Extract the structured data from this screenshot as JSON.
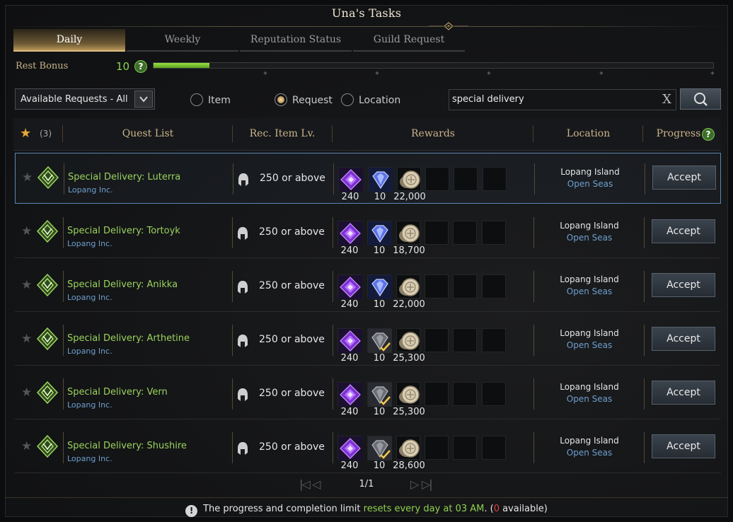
{
  "window": {
    "title": "Una's Tasks"
  },
  "tabs": [
    {
      "label": "Daily",
      "active": true
    },
    {
      "label": "Weekly",
      "active": false
    },
    {
      "label": "Reputation Status",
      "active": false
    },
    {
      "label": "Guild Request",
      "active": false
    }
  ],
  "rest_bonus": {
    "label": "Rest Bonus",
    "value": "10",
    "help": "?",
    "progress_percent": 10
  },
  "filter": {
    "dropdown_value": "Available Requests - All",
    "dropdown_arrow": "chevron-down-icon",
    "radios": [
      {
        "label": "Item",
        "selected": false
      },
      {
        "label": "Request",
        "selected": true
      },
      {
        "label": "Location",
        "selected": false
      }
    ],
    "search_value": "special delivery",
    "clear_label": "X",
    "search_icon": "magnifier-icon"
  },
  "header": {
    "favorites_count": "(3)",
    "quest_list": "Quest List",
    "rec_item_lv": "Rec. Item Lv.",
    "rewards": "Rewards",
    "location": "Location",
    "progress": "Progress",
    "progress_help": "?"
  },
  "rows": [
    {
      "name": "Special Delivery: Luterra",
      "org": "Lopang Inc.",
      "level": "250 or above",
      "reward1": "240",
      "reward2": "10",
      "reward2_checked": false,
      "reward3": "22,000",
      "loc1": "Lopang Island",
      "loc2": "Open Seas",
      "action": "Accept"
    },
    {
      "name": "Special Delivery: Tortoyk",
      "org": "Lopang Inc.",
      "level": "250 or above",
      "reward1": "240",
      "reward2": "10",
      "reward2_checked": false,
      "reward3": "18,700",
      "loc1": "Lopang Island",
      "loc2": "Open Seas",
      "action": "Accept"
    },
    {
      "name": "Special Delivery: Anikka",
      "org": "Lopang Inc.",
      "level": "250 or above",
      "reward1": "240",
      "reward2": "10",
      "reward2_checked": false,
      "reward3": "22,000",
      "loc1": "Lopang Island",
      "loc2": "Open Seas",
      "action": "Accept"
    },
    {
      "name": "Special Delivery: Arthetine",
      "org": "Lopang Inc.",
      "level": "250 or above",
      "reward1": "240",
      "reward2": "10",
      "reward2_checked": true,
      "reward3": "25,300",
      "loc1": "Lopang Island",
      "loc2": "Open Seas",
      "action": "Accept"
    },
    {
      "name": "Special Delivery: Vern",
      "org": "Lopang Inc.",
      "level": "250 or above",
      "reward1": "240",
      "reward2": "10",
      "reward2_checked": true,
      "reward3": "25,300",
      "loc1": "Lopang Island",
      "loc2": "Open Seas",
      "action": "Accept"
    },
    {
      "name": "Special Delivery: Shushire",
      "org": "Lopang Inc.",
      "level": "250 or above",
      "reward1": "240",
      "reward2": "10",
      "reward2_checked": true,
      "reward3": "28,600",
      "loc1": "Lopang Island",
      "loc2": "Open Seas",
      "action": "Accept"
    }
  ],
  "pager": {
    "text": "1/1"
  },
  "footer": {
    "info_icon": "!",
    "prefix": "The progress and completion limit ",
    "highlight": "resets every day at 03 AM",
    "mid": ". (",
    "available_count": "0",
    "suffix": " available)"
  },
  "colors": {
    "accent_green": "#8fd14f",
    "gold": "#c9b48a",
    "link_blue": "#6e9fce",
    "warning_red": "#e0413a"
  }
}
